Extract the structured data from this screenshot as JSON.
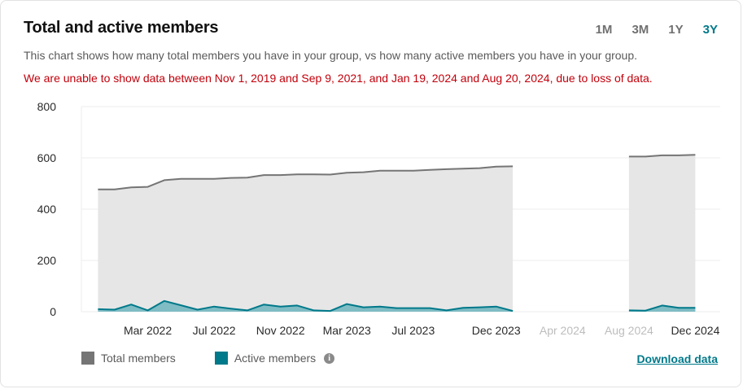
{
  "header": {
    "title": "Total and active members",
    "subtitle": "This chart shows how many total members you have in your group, vs how many active members you have in your group.",
    "warning": "We are unable to show data between Nov 1, 2019 and Sep 9, 2021, and Jan 19, 2024 and Aug 20, 2024, due to loss of data."
  },
  "ranges": [
    {
      "label": "1M",
      "active": false
    },
    {
      "label": "3M",
      "active": false
    },
    {
      "label": "1Y",
      "active": false
    },
    {
      "label": "3Y",
      "active": true
    }
  ],
  "legend": {
    "total_label": "Total members",
    "active_label": "Active members",
    "info_icon": "i"
  },
  "download_label": "Download data",
  "colors": {
    "total_line": "#757575",
    "total_fill": "#e6e6e6",
    "active_line": "#00798a",
    "active_fill": "#7fbcc4",
    "accent": "#00798a",
    "warning": "#c2000b",
    "faded_tick": "#bdbdbd"
  },
  "chart_data": {
    "type": "area",
    "ylim": [
      0,
      800
    ],
    "yticks": [
      0,
      200,
      400,
      600,
      800
    ],
    "grid": true,
    "legend_position": "bottom-left",
    "xticks": [
      {
        "label": "Mar 2022",
        "x": 3.0,
        "faded": false
      },
      {
        "label": "Jul 2022",
        "x": 7.0,
        "faded": false
      },
      {
        "label": "Nov 2022",
        "x": 11.0,
        "faded": false
      },
      {
        "label": "Mar 2023",
        "x": 15.0,
        "faded": false
      },
      {
        "label": "Jul 2023",
        "x": 19.0,
        "faded": false
      },
      {
        "label": "Dec 2023",
        "x": 24.0,
        "faded": false
      },
      {
        "label": "Apr 2024",
        "x": 28.0,
        "faded": true
      },
      {
        "label": "Aug 2024",
        "x": 32.0,
        "faded": true
      },
      {
        "label": "Dec 2024",
        "x": 36.0,
        "faded": false
      }
    ],
    "xlim": [
      -1.0,
      37.5
    ],
    "series": [
      {
        "name": "Total members",
        "segments": [
          {
            "x": [
              0,
              1,
              2,
              3,
              4,
              5,
              6,
              7,
              8,
              9,
              10,
              11,
              12,
              13,
              14,
              15,
              16,
              17,
              18,
              19,
              20,
              21,
              22,
              23,
              24,
              25
            ],
            "y": [
              477,
              477,
              485,
              487,
              513,
              518,
              518,
              518,
              522,
              523,
              533,
              533,
              536,
              536,
              535,
              542,
              544,
              550,
              550,
              550,
              553,
              556,
              558,
              560,
              566,
              567
            ]
          },
          {
            "x": [
              32,
              33,
              34,
              35,
              36
            ],
            "y": [
              605,
              605,
              610,
              610,
              612
            ]
          }
        ]
      },
      {
        "name": "Active members",
        "segments": [
          {
            "x": [
              0,
              1,
              2,
              3,
              4,
              5,
              6,
              7,
              8,
              9,
              10,
              11,
              12,
              13,
              14,
              15,
              16,
              17,
              18,
              19,
              20,
              21,
              22,
              23,
              24,
              25
            ],
            "y": [
              10,
              8,
              28,
              5,
              42,
              25,
              8,
              20,
              12,
              5,
              28,
              20,
              24,
              5,
              3,
              30,
              17,
              20,
              14,
              14,
              14,
              5,
              15,
              17,
              20,
              3
            ]
          },
          {
            "x": [
              32,
              33,
              34,
              35,
              36
            ],
            "y": [
              5,
              4,
              24,
              15,
              15
            ]
          }
        ]
      }
    ]
  }
}
